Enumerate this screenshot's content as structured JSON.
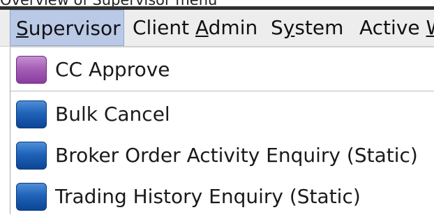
{
  "caption": "Overview of Supervisor menu",
  "menubar": {
    "items": [
      {
        "before": "",
        "mnemonic": "S",
        "after": "upervisor",
        "active": true
      },
      {
        "before": "Client ",
        "mnemonic": "A",
        "after": "dmin",
        "active": false
      },
      {
        "before": "S",
        "mnemonic": "y",
        "after": "stem",
        "active": false
      },
      {
        "before": "Active ",
        "mnemonic": "W",
        "after": "",
        "active": false
      }
    ]
  },
  "dropdown": {
    "items": [
      {
        "label": "CC Approve",
        "icon": "purple-square-icon",
        "icon_color": "#9b4fb0"
      },
      {
        "label": "Bulk Cancel",
        "icon": "blue-square-icon",
        "icon_color": "#1f63b9"
      },
      {
        "label": "Broker Order Activity Enquiry (Static)",
        "icon": "blue-square-icon",
        "icon_color": "#1f63b9"
      },
      {
        "label": "Trading History Enquiry (Static)",
        "icon": "blue-square-icon",
        "icon_color": "#1f63b9"
      }
    ]
  },
  "colors": {
    "menubar_bg": "#ededed",
    "active_menu_bg": "#b9c9e6",
    "dropdown_bg": "#ffffff"
  }
}
